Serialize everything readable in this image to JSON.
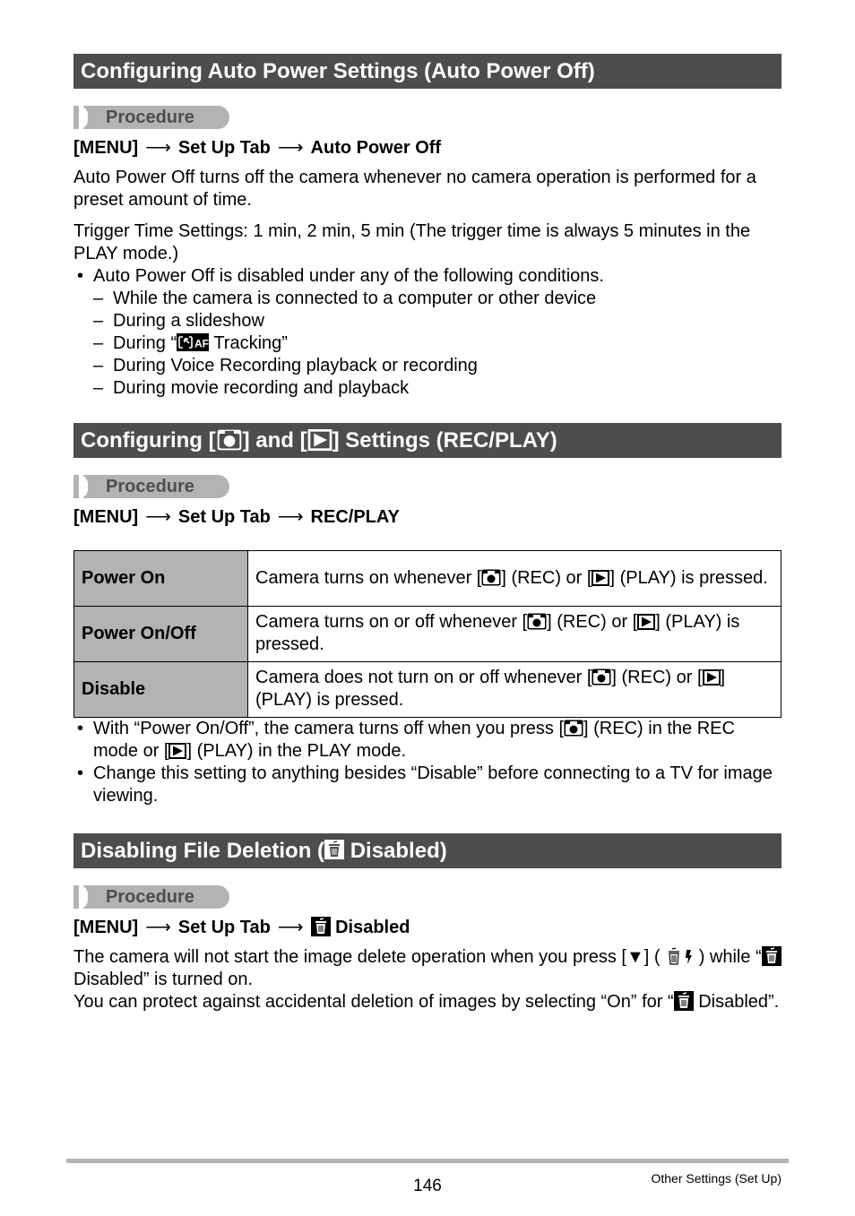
{
  "sections": [
    {
      "heading": "Configuring Auto Power Settings (Auto Power Off)",
      "procedure_label": "Procedure",
      "path": [
        "[MENU]",
        "Set Up Tab",
        "Auto Power Off"
      ],
      "paragraphs": [
        "Auto Power Off turns off the camera whenever no camera operation is performed for a preset amount of time.",
        "Trigger Time Settings: 1 min, 2 min, 5 min (The trigger time is always 5 minutes in the PLAY mode.)"
      ],
      "bullet": "Auto Power Off is disabled under any of the following conditions.",
      "conditions": [
        "While the camera is connected to a computer or other device",
        "During a slideshow",
        {
          "before": "During “",
          "icon": "af-tracking-icon",
          "after": " Tracking”"
        },
        "During Voice Recording playback or recording",
        "During movie recording and playback"
      ]
    },
    {
      "heading_parts": [
        "Configuring [",
        "] and [",
        "] Settings (REC/PLAY)"
      ],
      "procedure_label": "Procedure",
      "path": [
        "[MENU]",
        "Set Up Tab",
        "REC/PLAY"
      ],
      "table": [
        {
          "label": "Power On",
          "desc_parts": [
            "Camera turns on whenever [",
            "] (REC) or [",
            "] (PLAY) is pressed."
          ]
        },
        {
          "label": "Power On/Off",
          "desc_parts": [
            "Camera turns on or off whenever [",
            "] (REC) or [",
            "] (PLAY) is pressed."
          ]
        },
        {
          "label": "Disable",
          "desc_parts": [
            "Camera does not turn on or off whenever [",
            "] (REC) or [",
            "] (PLAY) is pressed."
          ]
        }
      ],
      "notes": [
        {
          "parts": [
            "With “Power On/Off”, the camera turns off when you press [",
            "] (REC) in the REC mode or [",
            "] (PLAY) in the PLAY mode."
          ]
        },
        {
          "text": "Change this setting to anything besides “Disable” before connecting to a TV for image viewing."
        }
      ]
    },
    {
      "heading_parts": [
        "Disabling File Deletion (",
        " Disabled)"
      ],
      "procedure_label": "Procedure",
      "path": [
        "[MENU]",
        "Set Up Tab",
        "Disabled"
      ],
      "para1_parts": [
        "The camera will not start the image delete operation when you press [▼] (",
        ") while “",
        " Disabled” is turned on."
      ],
      "para2_parts": [
        "You can protect against accidental deletion of images by selecting “On” for “",
        " Disabled”."
      ]
    }
  ],
  "footer": {
    "page_number": "146",
    "section_title": "Other Settings (Set Up)"
  },
  "arrow": "⟶"
}
